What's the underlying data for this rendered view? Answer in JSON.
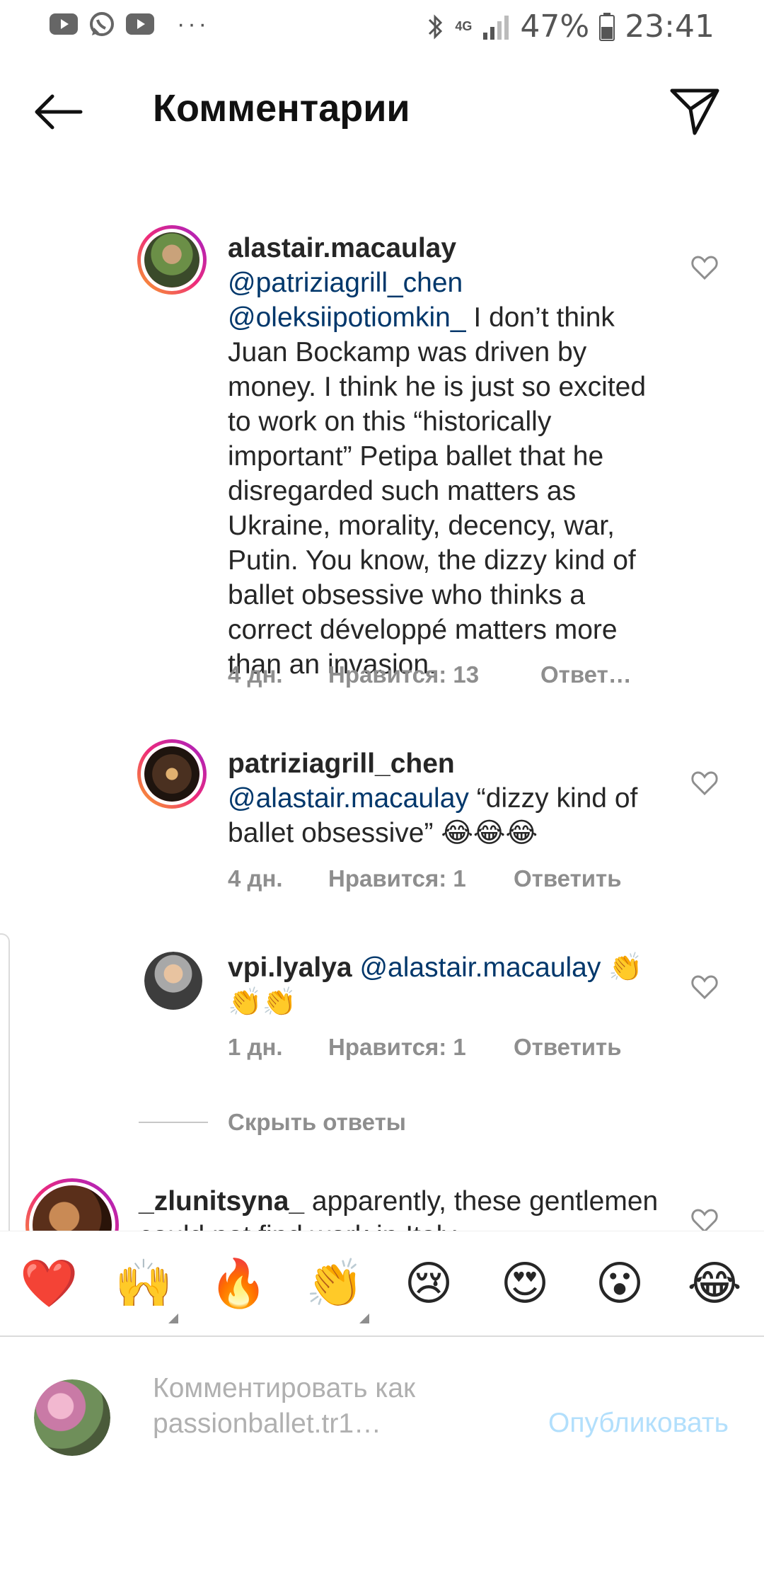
{
  "status_bar": {
    "battery": "47%",
    "time": "23:41",
    "network": "4G",
    "more": "···"
  },
  "header": {
    "title": "Комментарии"
  },
  "comments": [
    {
      "username": "alastair.macaulay",
      "mentions": "@patriziagrill_chen @oleksiipotiomkin_",
      "text": "I don’t think Juan Bockamp was driven by money. I think he is just so excited to work on this “historically important” Petipa ballet that he disregarded such matters as Ukraine, morality, decency, war, Putin. You know, the dizzy kind of ballet obsessive who thinks a correct développé matters more than an invasion.",
      "time": "4 дн.",
      "likes": "Нравится: 13",
      "reply": "Ответ…"
    },
    {
      "username": "patriziagrill_chen",
      "mentions": "@alastair.macaulay",
      "text": "“dizzy kind of ballet obsessive” 😂😂😂",
      "time": "4 дн.",
      "likes": "Нравится: 1",
      "reply": "Ответить"
    },
    {
      "username": "vpi.lyalya",
      "mentions": "@alastair.macaulay",
      "text": "👏👏👏",
      "time": "1 дн.",
      "likes": "Нравится: 1",
      "reply": "Ответить"
    },
    {
      "username": "_zlunitsyna_",
      "text": "apparently, these gentlemen could not find work in Italy"
    }
  ],
  "hide_replies": "Скрыть ответы",
  "emojis": [
    "❤️",
    "🙌",
    "🔥",
    "👏",
    "😢",
    "😍",
    "😮",
    "😂"
  ],
  "compose": {
    "placeholder": "Комментировать как passionballet.tr1…",
    "publish": "Опубликовать"
  }
}
